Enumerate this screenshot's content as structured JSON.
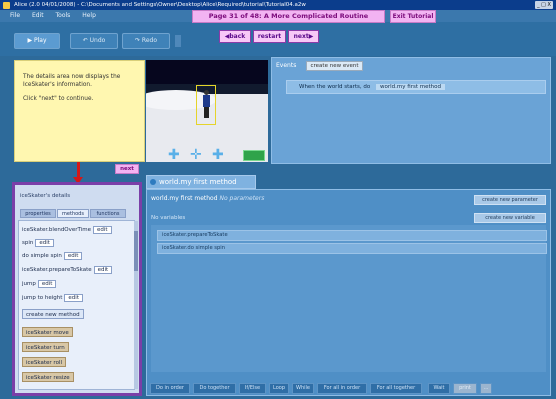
{
  "window": {
    "title": "Alice (2.0 04/01/2008) - C:\\Documents and Settings\\Owner\\Desktop\\Alice\\Required\\tutorial\\Tutorial04.a2w",
    "min_close_label": "_ □ X"
  },
  "menu": [
    "File",
    "Edit",
    "Tools",
    "Help"
  ],
  "tutorial": {
    "title": "Page 31 of 48: A More Complicated Routine",
    "exit_label": "Exit Tutorial",
    "back_label": "back",
    "restart_label": "restart",
    "next_label": "next",
    "note_p1": "The details area now displays the IceSkater's information.",
    "note_p2": "Click \"next\" to continue.",
    "note_next_label": "next"
  },
  "toolbar": {
    "play_label": "Play",
    "undo_label": "Undo",
    "redo_label": "Redo"
  },
  "events": {
    "title": "Events",
    "create_new_label": "create new event",
    "row_text": "When the world starts, do",
    "row_tile": "world.my first method"
  },
  "details": {
    "header": "iceSkater's details",
    "tabs": [
      "properties",
      "methods",
      "functions"
    ],
    "items": [
      {
        "label": "iceSkater.blendOverTime",
        "value": "edit"
      },
      {
        "label": "spin",
        "value": "edit"
      },
      {
        "label": "do simple spin",
        "value": "edit"
      },
      {
        "label": "iceSkater.prepareToSkate",
        "value": "edit"
      },
      {
        "label": "jump",
        "value": "edit"
      },
      {
        "label": "jump to height",
        "value": "edit"
      },
      {
        "label": "create new method",
        "value": ""
      },
      {
        "label": "iceSkater move",
        "value": ""
      },
      {
        "label": "iceSkater turn",
        "value": ""
      },
      {
        "label": "iceSkater roll",
        "value": ""
      },
      {
        "label": "iceSkater resize",
        "value": ""
      }
    ]
  },
  "editor": {
    "tab_label": "world.my first method",
    "signature": "world.my first method",
    "no_params": "No parameters",
    "no_vars": "No variables",
    "create_param_label": "create new parameter",
    "create_var_label": "create new variable",
    "lines": [
      "iceSkater.prepareToSkate",
      "iceSkater.do simple spin"
    ],
    "bottom_buttons": [
      "Do in order",
      "Do together",
      "If/Else",
      "Loop",
      "While",
      "For all in order",
      "For all together",
      "Wait",
      "print",
      "..."
    ]
  },
  "colors": {
    "accent": "#f2b3f2",
    "panel": "#6aa3d6",
    "note": "#fff7b0",
    "arrow": "#d41818"
  }
}
